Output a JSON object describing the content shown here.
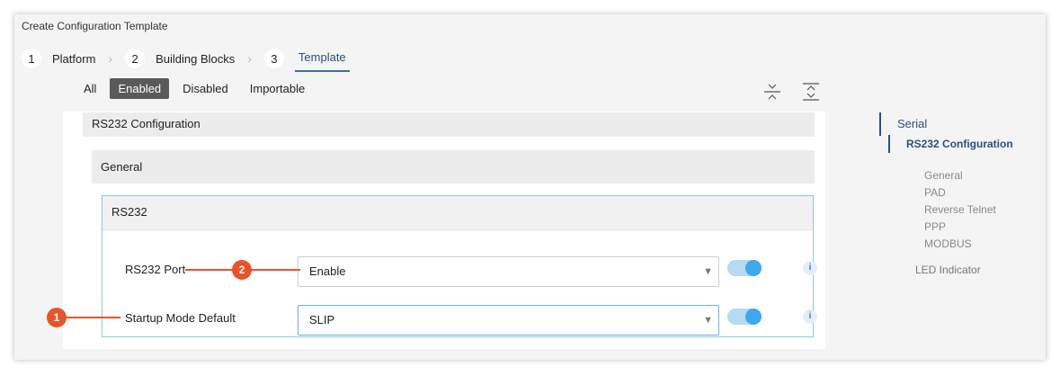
{
  "window": {
    "title": "Create Configuration Template"
  },
  "wizard": {
    "steps": [
      {
        "num": "1",
        "label": "Platform"
      },
      {
        "num": "2",
        "label": "Building Blocks"
      },
      {
        "num": "3",
        "label": "Template"
      }
    ],
    "active_step": "3"
  },
  "filters": {
    "all": "All",
    "enabled": "Enabled",
    "disabled": "Disabled",
    "importable": "Importable",
    "selected": "Enabled"
  },
  "toolbar": {
    "collapse_icon": "collapse-all-icon",
    "expand_icon": "expand-all-icon"
  },
  "sections": {
    "rs232_configuration": "RS232 Configuration",
    "general": "General",
    "rs232": "RS232"
  },
  "fields": {
    "rs232_port": {
      "label": "RS232 Port",
      "value": "Enable",
      "toggle_on": true
    },
    "startup_mode": {
      "label": "Startup Mode Default",
      "value": "SLIP",
      "toggle_on": true
    }
  },
  "callouts": {
    "one": "1",
    "two": "2"
  },
  "icons": {
    "caret": "▼",
    "info": "i"
  },
  "colors": {
    "accent": "#2d4f7a",
    "callout": "#e8542a",
    "toggle": "#3fa8ec",
    "focus_border": "#6ab2e0"
  },
  "nav": {
    "serial": "Serial",
    "rs232_configuration": "RS232 Configuration",
    "items": [
      "General",
      "PAD",
      "Reverse Telnet",
      "PPP",
      "MODBUS"
    ],
    "led": "LED Indicator"
  }
}
